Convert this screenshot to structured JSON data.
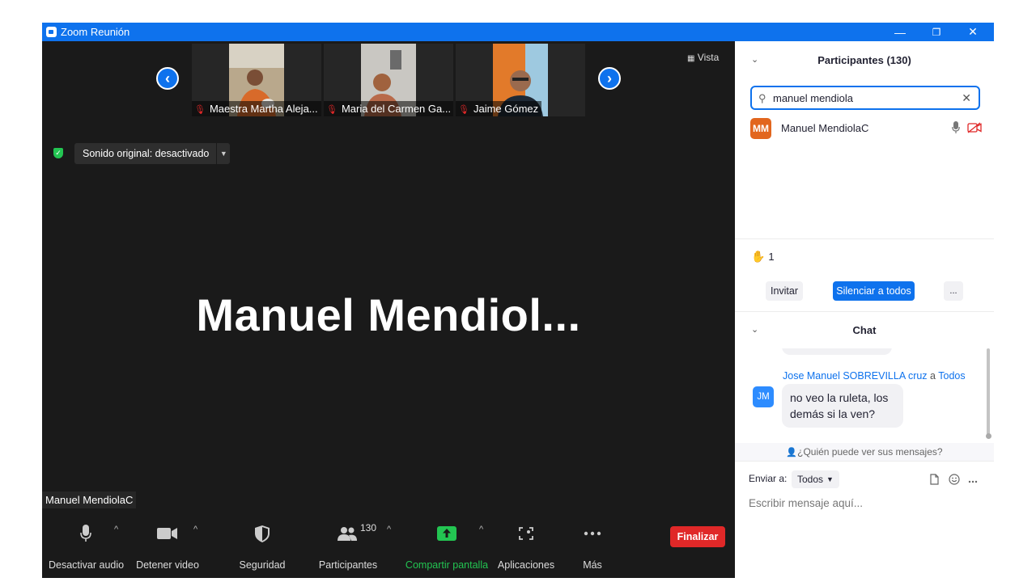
{
  "window": {
    "title": "Zoom Reunión",
    "controls": {
      "minimize": "—",
      "restore": "❐",
      "close": "✕"
    }
  },
  "thumbnails": [
    {
      "name": "Maestra Martha Aleja...",
      "muted": true
    },
    {
      "name": "Maria del Carmen Ga...",
      "muted": true
    },
    {
      "name": "Jaime Gómez",
      "muted": true
    }
  ],
  "nav": {
    "prev": "‹",
    "next": "›"
  },
  "view_button": "Vista",
  "original_sound": {
    "label": "Sonido original: desactivado"
  },
  "active_speaker": {
    "display_name": "Manuel  Mendiol...",
    "name_tag": "Manuel MendiolaC"
  },
  "toolbar": {
    "audio": "Desactivar audio",
    "video": "Detener video",
    "security": "Seguridad",
    "participants": "Participantes",
    "participants_count": "130",
    "share": "Compartir pantalla",
    "apps": "Aplicaciones",
    "more": "Más",
    "end": "Finalizar"
  },
  "participants_panel": {
    "title": "Participantes (130)",
    "search_value": "manuel mendiola",
    "results": [
      {
        "initials": "MM",
        "name": "Manuel MendiolaC",
        "avatar_color": "#e2661e"
      }
    ],
    "raised_hands": "1",
    "buttons": {
      "invite": "Invitar",
      "mute_all": "Silenciar a todos",
      "more": "..."
    }
  },
  "chat": {
    "title": "Chat",
    "message": {
      "avatar": "JM",
      "avatar_color": "#2d8cff",
      "sender": "Jose Manuel SOBREVILLA cruz",
      "connector": "a",
      "recipient": "Todos",
      "text": "no veo la ruleta, los demás si la ven?"
    },
    "privacy_note": "¿Quién puede ver sus mensajes?",
    "send_to_label": "Enviar a:",
    "send_to_value": "Todos",
    "input_placeholder": "Escribir mensaje aquí..."
  },
  "colors": {
    "accent": "#0e72ed",
    "danger": "#e02828",
    "share": "#23c552",
    "dark_bg": "#1a1a1a"
  }
}
